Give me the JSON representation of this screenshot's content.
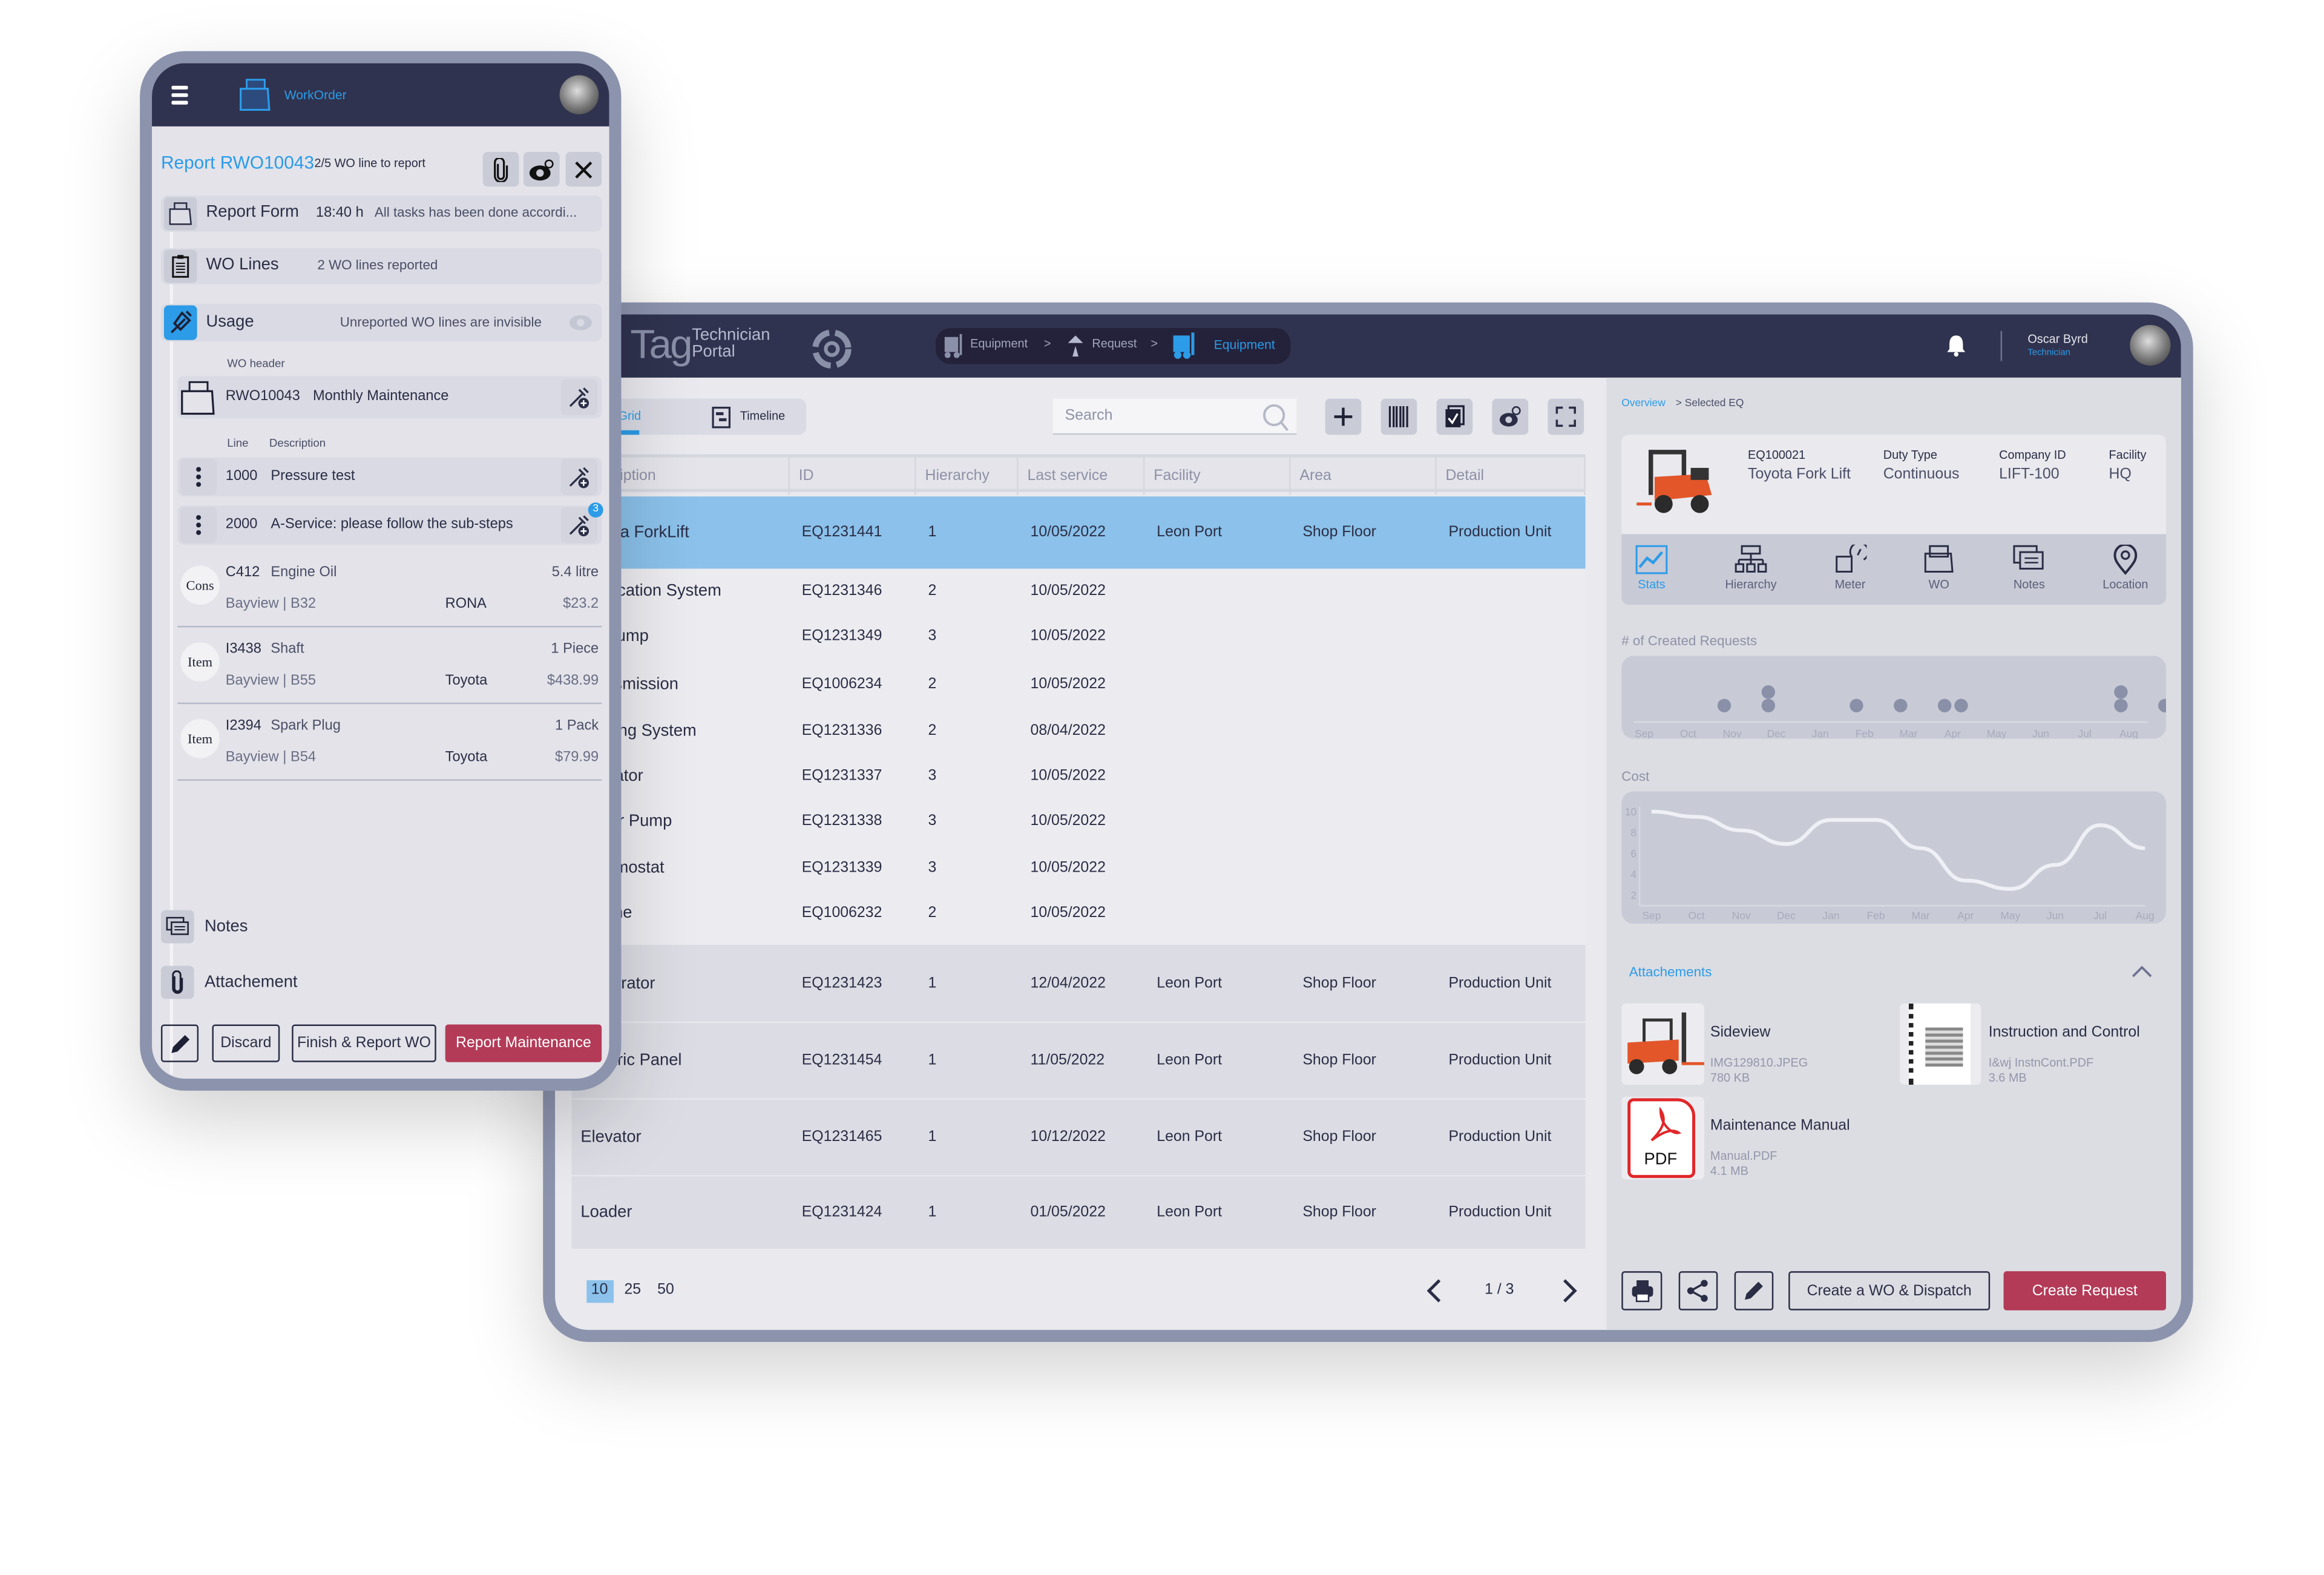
{
  "phone": {
    "app_title": "WorkOrder",
    "report_title": "Report RWO10043",
    "report_progress": "2/5 WO line to report",
    "report_form": {
      "label": "Report Form",
      "time": "18:40 h",
      "text": "All tasks has been done accordi..."
    },
    "wo_lines": {
      "label": "WO Lines",
      "text": "2 WO lines reported"
    },
    "usage": {
      "label": "Usage",
      "text": "Unreported WO lines are invisible"
    },
    "wo_header_label": "WO header",
    "wo_header": {
      "id": "RWO10043",
      "name": "Monthly Maintenance"
    },
    "line_col": "Line",
    "desc_col": "Description",
    "lines": [
      {
        "id": "1000",
        "desc": "Pressure test",
        "badge": ""
      },
      {
        "id": "2000",
        "desc": "A-Service: please follow the sub-steps",
        "badge": "3"
      }
    ],
    "items": [
      {
        "type": "Consumable",
        "code": "C412",
        "name": "Engine Oil",
        "qty": "5.4 litre",
        "loc": "Bayview | B32",
        "vendor": "RONA",
        "price": "$23.2"
      },
      {
        "type": "Item",
        "code": "I3438",
        "name": "Shaft",
        "qty": "1 Piece",
        "loc": "Bayview | B55",
        "vendor": "Toyota",
        "price": "$438.99"
      },
      {
        "type": "Item",
        "code": "I2394",
        "name": "Spark Plug",
        "qty": "1 Pack",
        "loc": "Bayview | B54",
        "vendor": "Toyota",
        "price": "$79.99"
      }
    ],
    "notes_label": "Notes",
    "attachment_label": "Attachement",
    "buttons": {
      "discard": "Discard",
      "finish": "Finish & Report WO",
      "report": "Report Maintenance"
    }
  },
  "portal": {
    "logo_main": "Tag",
    "logo_sub1": "Technician",
    "logo_sub2": "Portal",
    "breadcrumb": [
      {
        "label": "Equipment",
        "active": false
      },
      {
        "label": "Request",
        "active": false
      },
      {
        "label": "Equipment",
        "active": true
      }
    ],
    "user": {
      "name": "Oscar Byrd",
      "role": "Technician"
    },
    "view_tabs": [
      {
        "label": "Grid",
        "active": true
      },
      {
        "label": "Timeline",
        "active": false
      }
    ],
    "search_placeholder": "Search",
    "columns": [
      "Description",
      "ID",
      "Hierarchy",
      "Last service",
      "Facility",
      "Area",
      "Detail"
    ],
    "rows": [
      {
        "desc": "Toyota ForkLift",
        "id": "EQ1231441",
        "h": "1",
        "last": "10/05/2022",
        "fac": "Leon Port",
        "area": "Shop Floor",
        "detail": "Production Unit",
        "selected": true
      },
      {
        "desc": "Lubrication System",
        "id": "EQ1231346",
        "h": "2",
        "last": "10/05/2022",
        "fac": "",
        "area": "",
        "detail": ""
      },
      {
        "desc": "Oil Pump",
        "id": "EQ1231349",
        "h": "3",
        "last": "10/05/2022",
        "fac": "",
        "area": "",
        "detail": ""
      },
      {
        "desc": "Transmission",
        "id": "EQ1006234",
        "h": "2",
        "last": "10/05/2022",
        "fac": "",
        "area": "",
        "detail": ""
      },
      {
        "desc": "Cooling System",
        "id": "EQ1231336",
        "h": "2",
        "last": "08/04/2022",
        "fac": "",
        "area": "",
        "detail": ""
      },
      {
        "desc": "Radiator",
        "id": "EQ1231337",
        "h": "3",
        "last": "10/05/2022",
        "fac": "",
        "area": "",
        "detail": ""
      },
      {
        "desc": "Water Pump",
        "id": "EQ1231338",
        "h": "3",
        "last": "10/05/2022",
        "fac": "",
        "area": "",
        "detail": ""
      },
      {
        "desc": "Thermostat",
        "id": "EQ1231339",
        "h": "3",
        "last": "10/05/2022",
        "fac": "",
        "area": "",
        "detail": ""
      },
      {
        "desc": "Engine",
        "id": "EQ1006232",
        "h": "2",
        "last": "10/05/2022",
        "fac": "",
        "area": "",
        "detail": ""
      },
      {
        "desc": "Generator",
        "id": "EQ1231423",
        "h": "1",
        "last": "12/04/2022",
        "fac": "Leon Port",
        "area": "Shop Floor",
        "detail": "Production Unit"
      },
      {
        "desc": "Electric Panel",
        "id": "EQ1231454",
        "h": "1",
        "last": "11/05/2022",
        "fac": "Leon Port",
        "area": "Shop Floor",
        "detail": "Production Unit"
      },
      {
        "desc": "Elevator",
        "id": "EQ1231465",
        "h": "1",
        "last": "10/12/2022",
        "fac": "Leon Port",
        "area": "Shop Floor",
        "detail": "Production Unit"
      },
      {
        "desc": "Loader",
        "id": "EQ1231424",
        "h": "1",
        "last": "01/05/2022",
        "fac": "Leon Port",
        "area": "Shop Floor",
        "detail": "Production Unit"
      }
    ],
    "page_sizes": [
      "10",
      "25",
      "50"
    ],
    "page_size_selected": "10",
    "page_indicator": "1 / 3",
    "detail": {
      "crumb_link": "Overview",
      "crumb_current": "> Selected EQ",
      "eq_id": "EQ100021",
      "eq_name": "Toyota  Fork Lift",
      "duty_label": "Duty Type",
      "duty": "Continuous",
      "company_label": "Company ID",
      "company": "LIFT-100",
      "facility_label": "Facility",
      "facility": "HQ",
      "tabs": [
        "Stats",
        "Hierarchy",
        "Meter",
        "WO",
        "Notes",
        "Location"
      ],
      "active_tab": "Stats",
      "requests_title": "# of Created Requests",
      "cost_title": "Cost",
      "attachments_title": "Attachements",
      "attachments": [
        {
          "title": "Sideview",
          "file": "IMG129810.JPEG",
          "size": "780 KB",
          "kind": "image"
        },
        {
          "title": "Instruction and Control",
          "file": "I&wj InstnCont.PDF",
          "size": "3.6 MB",
          "kind": "document"
        },
        {
          "title": "Maintenance Manual",
          "file": "Manual.PDF",
          "size": "4.1 MB",
          "kind": "pdf",
          "icon_text": "PDF"
        }
      ],
      "buttons": {
        "dispatch": "Create a WO & Dispatch",
        "request": "Create Request"
      }
    }
  },
  "colors": {
    "accent": "#2c9be8",
    "header": "#30334f",
    "danger": "#b33b58",
    "selected_row": "#8bc1ea",
    "frame": "#8c93ad"
  },
  "chart_data": [
    {
      "type": "scatter",
      "title": "# of Created Requests",
      "categories": [
        "Sep",
        "Oct",
        "Nov",
        "Dec",
        "Jan",
        "Feb",
        "Mar",
        "Apr",
        "May",
        "Jun",
        "Jul",
        "Aug"
      ],
      "values": [
        0,
        1,
        2,
        0,
        1,
        1,
        2,
        0,
        0,
        0,
        2,
        1
      ],
      "grid": false
    },
    {
      "type": "line",
      "title": "Cost",
      "categories": [
        "Sep",
        "Oct",
        "Nov",
        "Dec",
        "Jan",
        "Feb",
        "Mar",
        "Apr",
        "May",
        "Jun",
        "Jul",
        "Aug"
      ],
      "values": [
        10,
        9.5,
        8.2,
        6.9,
        9.2,
        9.2,
        6.5,
        3.4,
        2.6,
        4.9,
        8.7,
        6.5
      ],
      "yticks": [
        2,
        4,
        6,
        8,
        10
      ],
      "ylim": [
        1,
        10.5
      ],
      "grid": false
    }
  ]
}
